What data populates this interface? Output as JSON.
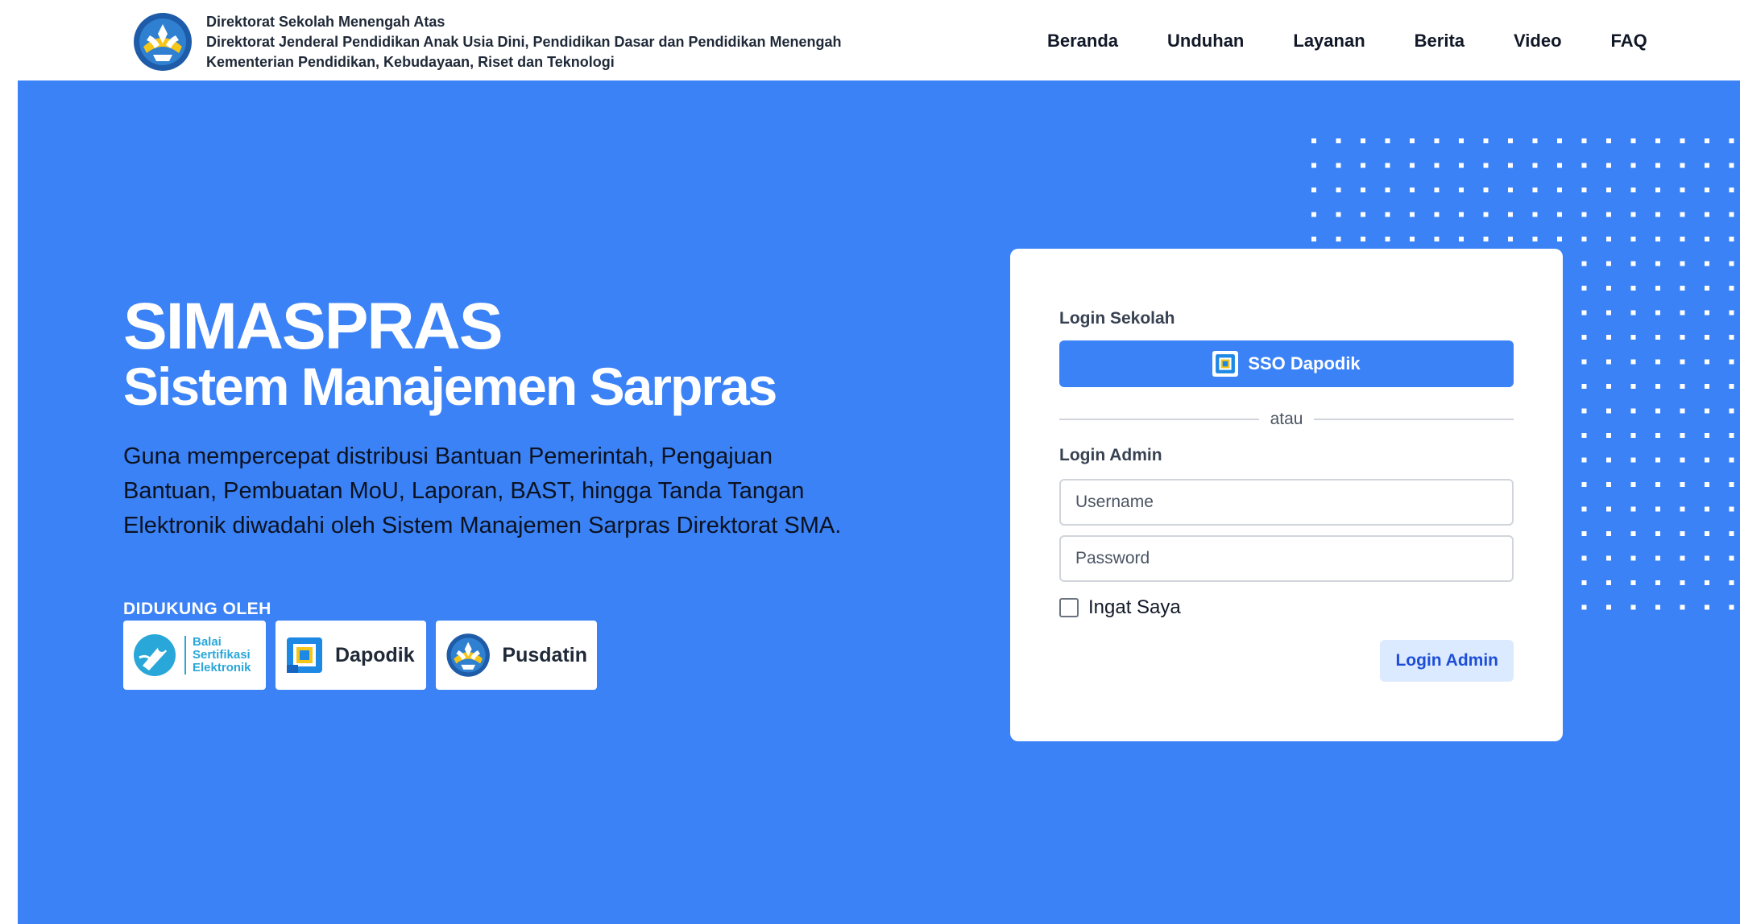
{
  "header": {
    "org_lines": [
      "Direktorat Sekolah Menengah Atas",
      "Direktorat Jenderal Pendidikan Anak Usia Dini, Pendidikan Dasar dan Pendidikan Menengah",
      "Kementerian Pendidikan, Kebudayaan, Riset dan Teknologi"
    ],
    "logo_icon": "tut-wuri-handayani-logo",
    "nav": [
      "Beranda",
      "Unduhan",
      "Layanan",
      "Berita",
      "Video",
      "FAQ"
    ]
  },
  "hero": {
    "title": "SIMASPRAS",
    "subtitle": "Sistem Manajemen Sarpras",
    "description": "Guna mempercepat distribusi Bantuan Pemerintah, Pengajuan Bantuan, Pembuatan MoU, Laporan, BAST, hingga Tanda Tangan Elektronik diwadahi oleh Sistem Manajemen Sarpras Direktorat SMA.",
    "supported_by": "DIDUKUNG OLEH",
    "partners": {
      "bse": {
        "lines": [
          "Balai",
          "Sertifikasi",
          "Elektronik"
        ],
        "icon": "bse-logo"
      },
      "dapodik": {
        "name": "Dapodik",
        "icon": "dapodik-logo"
      },
      "pusdatin": {
        "name": "Pusdatin",
        "icon": "tut-wuri-handayani-logo"
      }
    }
  },
  "login": {
    "school_label": "Login Sekolah",
    "sso_button": "SSO Dapodik",
    "divider_text": "atau",
    "admin_label": "Login Admin",
    "username_placeholder": "Username",
    "password_placeholder": "Password",
    "remember_label": "Ingat Saya",
    "admin_button": "Login Admin"
  },
  "colors": {
    "hero_blue": "#3b82f6",
    "admin_button_bg": "#dbeafe",
    "admin_button_text": "#1d4ed8",
    "bse_cyan": "#2aa7d9"
  }
}
